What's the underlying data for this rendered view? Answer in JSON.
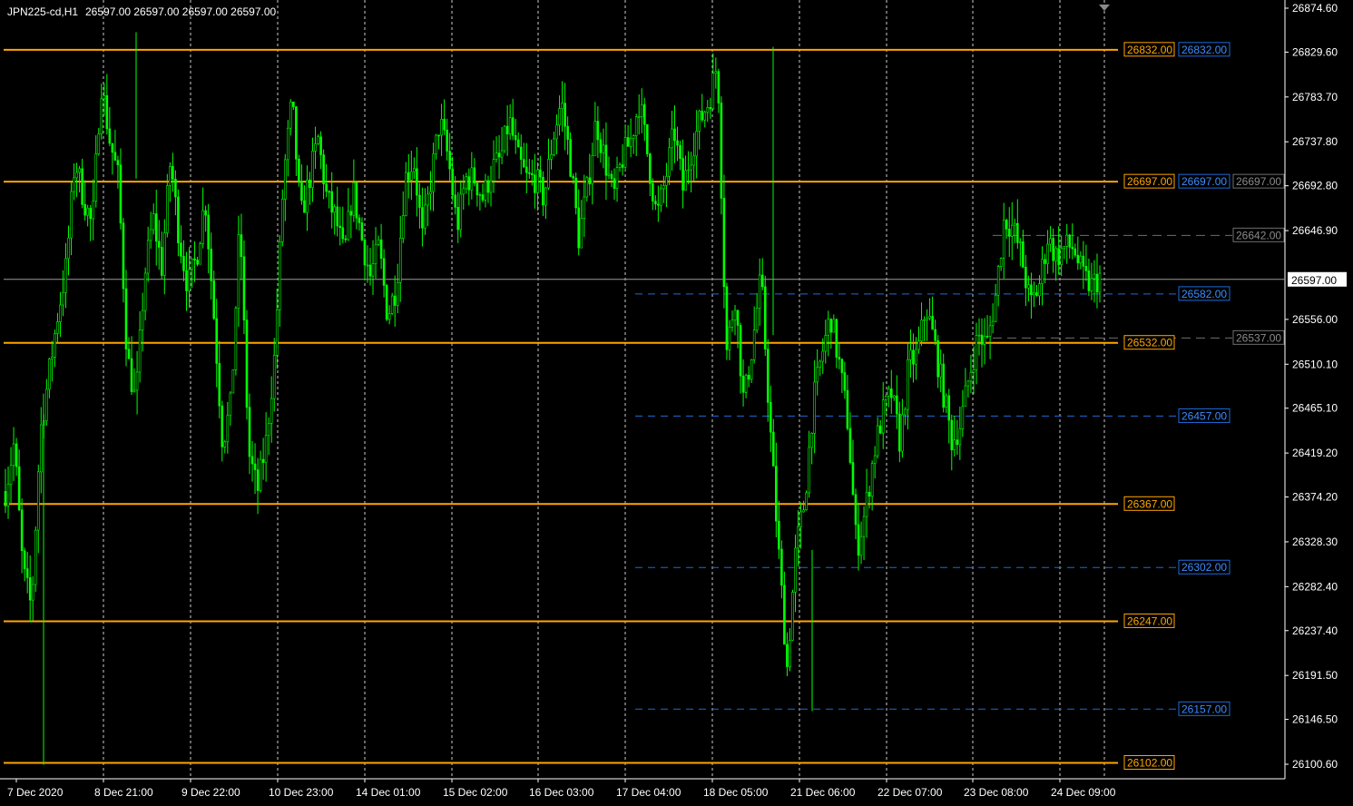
{
  "header": {
    "symbol_timeframe": "JPN225-cd,H1",
    "ohlc": "26597.00 26597.00 26597.00 26597.00"
  },
  "colors": {
    "background": "#000000",
    "candle": "#00ff00",
    "grid": "#ffffff",
    "resistance": "#ffa500",
    "support": "#1e6bd8",
    "dashed_gray": "#6e6e6e",
    "current_price": "#ffffff"
  },
  "chart_data": {
    "type": "candlestick",
    "title": "JPN225-cd,H1",
    "ylim": [
      26075,
      26885
    ],
    "y_ticks": [
      "26874.60",
      "26829.60",
      "26783.70",
      "26737.80",
      "26692.80",
      "26646.90",
      "26556.00",
      "26510.10",
      "26465.10",
      "26419.20",
      "26374.20",
      "26328.30",
      "26282.40",
      "26237.40",
      "26191.50",
      "26146.50",
      "26100.60"
    ],
    "x_ticks": [
      "7 Dec 2020",
      "8 Dec 21:00",
      "9 Dec 22:00",
      "10 Dec 23:00",
      "14 Dec 01:00",
      "15 Dec 02:00",
      "16 Dec 03:00",
      "17 Dec 04:00",
      "18 Dec 05:00",
      "21 Dec 06:00",
      "22 Dec 07:00",
      "23 Dec 08:00",
      "24 Dec 09:00"
    ],
    "current_price": "26597.00",
    "horizontal_levels": [
      {
        "value": 26832,
        "label": "26832.00",
        "style": "orange"
      },
      {
        "value": 26697,
        "label": "26697.00",
        "style": "orange"
      },
      {
        "value": 26532,
        "label": "26532.00",
        "style": "orange"
      },
      {
        "value": 26367,
        "label": "26367.00",
        "style": "orange"
      },
      {
        "value": 26247,
        "label": "26247.00",
        "style": "orange"
      },
      {
        "value": 26102,
        "label": "26102.00",
        "style": "orange"
      }
    ],
    "blue_levels": [
      {
        "value": 26832,
        "label": "26832.00",
        "boxed_only": true
      },
      {
        "value": 26697,
        "label": "26697.00",
        "boxed_only": true
      },
      {
        "value": 26582,
        "label": "26582.00"
      },
      {
        "value": 26457,
        "label": "26457.00"
      },
      {
        "value": 26302,
        "label": "26302.00"
      },
      {
        "value": 26157,
        "label": "26157.00"
      }
    ],
    "gray_levels": [
      {
        "value": 26697,
        "label": "26697.00",
        "boxed_only": true
      },
      {
        "value": 26642,
        "label": "26642.00"
      },
      {
        "value": 26537,
        "label": "26537.00"
      }
    ],
    "close_path": [
      26380,
      26430,
      26300,
      26260,
      26440,
      26500,
      26560,
      26610,
      26720,
      26680,
      26650,
      26800,
      26740,
      26700,
      26520,
      26470,
      26600,
      26660,
      26610,
      26720,
      26640,
      26590,
      26620,
      26680,
      26560,
      26430,
      26470,
      26660,
      26420,
      26380,
      26430,
      26520,
      26700,
      26780,
      26660,
      26700,
      26740,
      26680,
      26660,
      26620,
      26690,
      26640,
      26600,
      26630,
      26560,
      26590,
      26700,
      26720,
      26640,
      26700,
      26760,
      26720,
      26650,
      26700,
      26700,
      26680,
      26710,
      26720,
      26760,
      26720,
      26700,
      26700,
      26680,
      26740,
      26780,
      26720,
      26640,
      26690,
      26760,
      26720,
      26680,
      26720,
      26740,
      26780,
      26720,
      26660,
      26700,
      26750,
      26690,
      26730,
      26760,
      26780,
      26820,
      26520,
      26580,
      26470,
      26530,
      26600,
      26450,
      26320,
      26200,
      26320,
      26370,
      26470,
      26520,
      26560,
      26510,
      26450,
      26320,
      26360,
      26420,
      26460,
      26480,
      26430,
      26510,
      26520,
      26570,
      26530,
      26480,
      26430,
      26450,
      26500,
      26540,
      26530,
      26580,
      26660,
      26650,
      26620,
      26570,
      26590,
      26640,
      26620,
      26630,
      26630,
      26600,
      26590,
      26600
    ]
  }
}
